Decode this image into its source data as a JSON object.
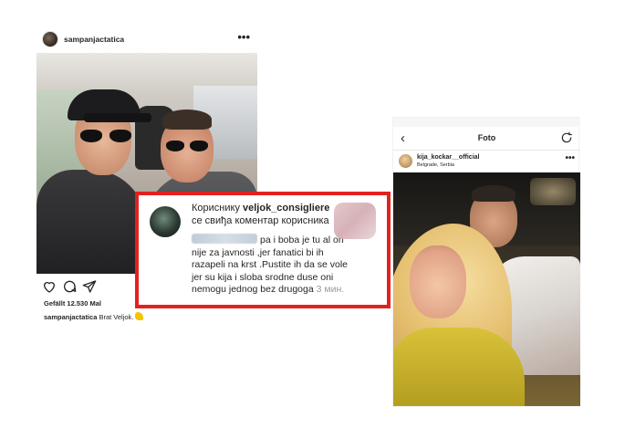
{
  "left_post": {
    "username": "sampanjactatica",
    "more_label": "•••",
    "likes": "Gefällt 12.530 Mal",
    "caption_user": "sampanjactatica",
    "caption_text": " Brat Veljok."
  },
  "comment": {
    "prefix": "Кориснику ",
    "user": "veljok_consigliere",
    "line2": "се свиђа коментар корисника",
    "text": "pa i boba je tu al on nije za javnosti ,jer fanatici bi ih razapeli na krst .Pustite ih da se vole jer su kija i sloba srodne duse oni nemogu jednog bez drugoga",
    "time": "3 мин."
  },
  "right_post": {
    "nav_title": "Foto",
    "back_icon": "‹",
    "username": "kija_kockar__official",
    "location": "Belgrade, Serbia",
    "more_label": "•••"
  },
  "colors": {
    "highlight_border": "#e3211f",
    "text": "#262626",
    "muted": "#999999"
  }
}
